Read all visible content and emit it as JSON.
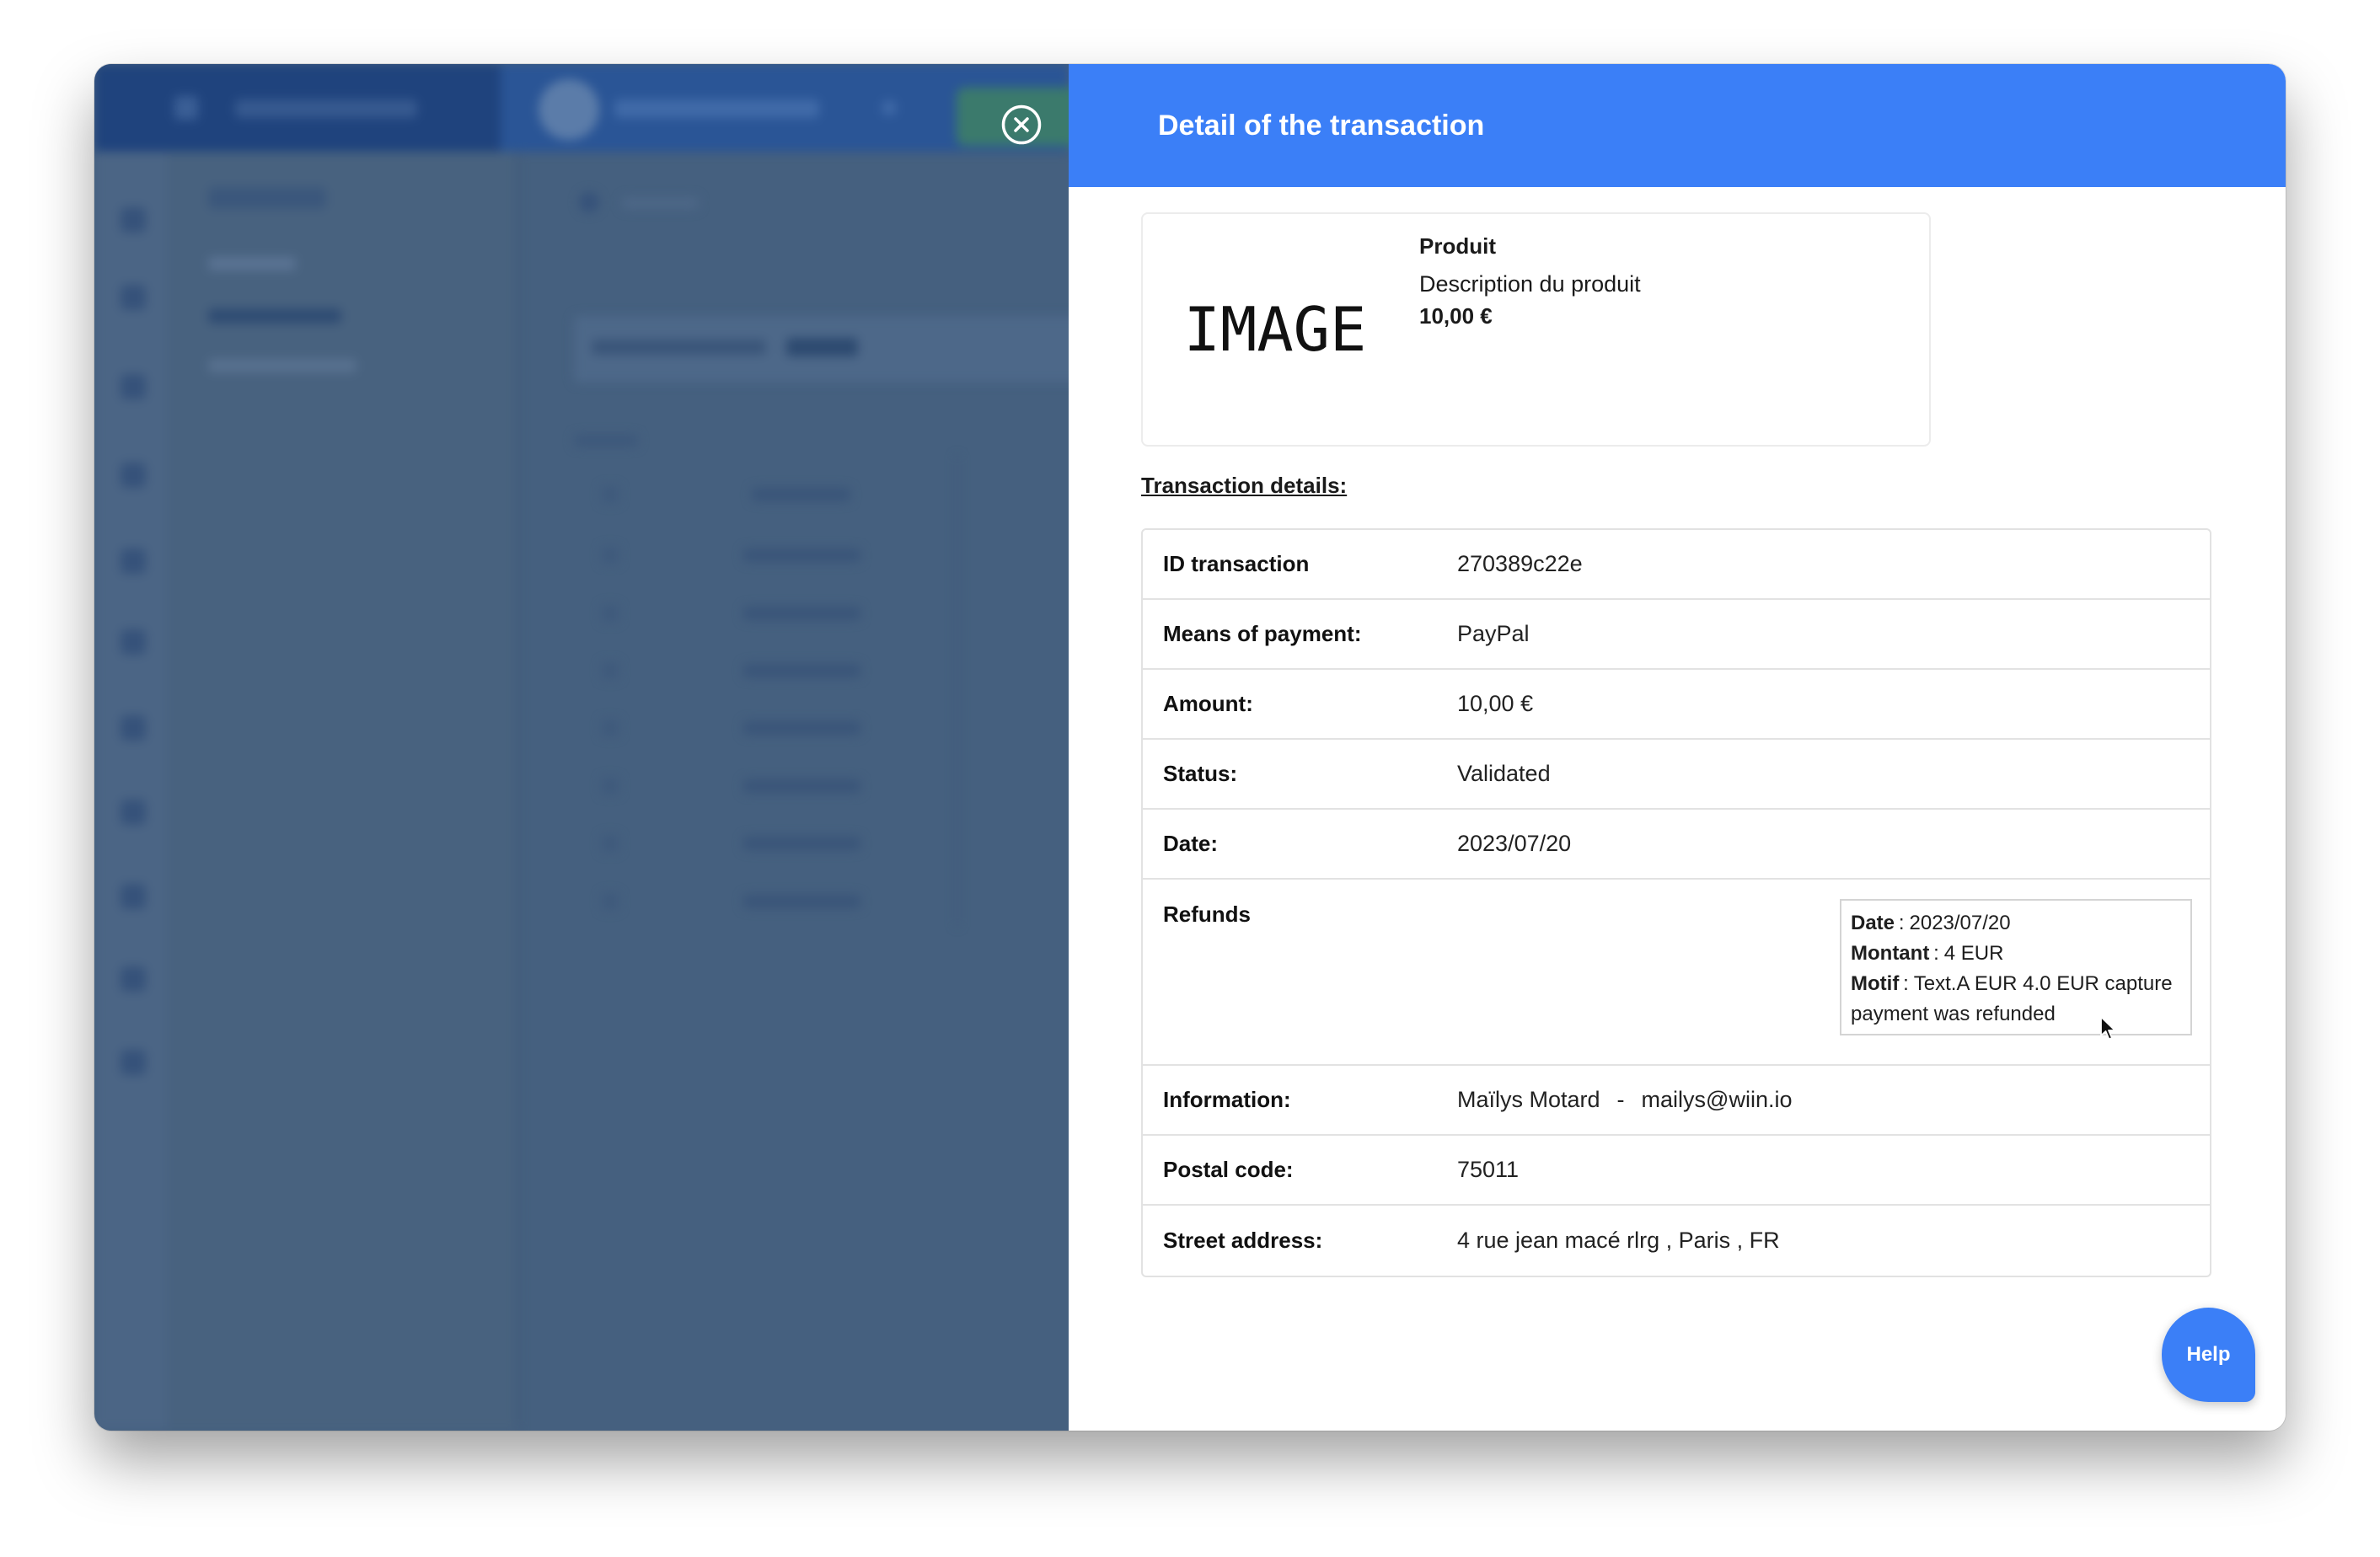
{
  "panel": {
    "title": "Detail of the transaction",
    "close_icon": "close-circle-icon"
  },
  "product": {
    "image_label": "IMAGE",
    "name": "Produit",
    "description": "Description du produit",
    "price": "10,00 €"
  },
  "details": {
    "heading": "Transaction details:",
    "rows": [
      {
        "label": "ID transaction",
        "value": "270389c22e"
      },
      {
        "label": "Means of payment:",
        "value": "PayPal"
      },
      {
        "label": "Amount:",
        "value": "10,00 €"
      },
      {
        "label": "Status:",
        "value": "Validated"
      },
      {
        "label": "Date:",
        "value": "2023/07/20"
      }
    ],
    "refunds": {
      "label": "Refunds",
      "separator": ":",
      "items": [
        {
          "date_label": "Date",
          "date": "2023/07/20",
          "amount_label": "Montant",
          "amount": "4 EUR",
          "reason_label": "Motif",
          "reason": "Text.A EUR 4.0 EUR capture payment was refunded"
        }
      ]
    },
    "information": {
      "label": "Information:",
      "name": "Maïlys Motard",
      "separator": "-",
      "email": "mailys@wiin.io"
    },
    "postal_code": {
      "label": "Postal code:",
      "value": "75011"
    },
    "street_address": {
      "label": "Street address:",
      "value": "4 rue jean macé rlrg , Paris , FR"
    }
  },
  "help_button": {
    "label": "Help"
  },
  "cursor_icon": "mouse-pointer-icon",
  "colors": {
    "accent": "#3b7ff7",
    "backdrop": "#45607f",
    "text": "#1a1a1a",
    "border": "#e2e2e2"
  }
}
